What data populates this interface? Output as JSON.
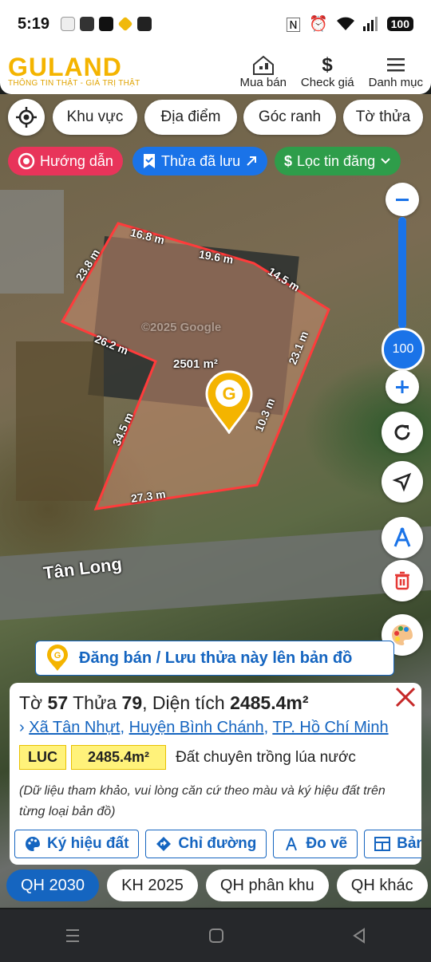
{
  "status_bar": {
    "time": "5:19",
    "battery": "100"
  },
  "header": {
    "logo_word": "GULAND",
    "logo_tagline": "THÔNG TIN THẬT - GIÁ TRỊ THẬT",
    "nav": [
      {
        "label": "Mua bán",
        "icon": "house-icon"
      },
      {
        "label": "Check giá",
        "icon": "dollar-icon"
      },
      {
        "label": "Danh mục",
        "icon": "menu-icon"
      }
    ]
  },
  "filters": {
    "location_icon": "crosshair-icon",
    "chips": [
      "Khu vực",
      "Địa điểm",
      "Góc ranh",
      "Tờ thửa"
    ]
  },
  "quick_actions": {
    "guide": "Hướng dẫn",
    "saved": "Thửa đã lưu",
    "filter": "Lọc tin đăng"
  },
  "map": {
    "watermark": "©2025 Google",
    "area_label": "2501 m²",
    "road_name": "Tân Long",
    "edge_labels": [
      "16.8 m",
      "19.6 m",
      "14.5 m",
      "23.8 m",
      "26.2 m",
      "23.1 m",
      "10.3 m",
      "34.5 m",
      "27.3 m"
    ],
    "zoom_value": "100",
    "colors": {
      "boundary": "#ff3b3b",
      "primary": "#1565c0",
      "accent": "#f4b400"
    }
  },
  "controls": [
    "zoom-out",
    "zoom-in",
    "refresh",
    "navigate",
    "measure",
    "delete",
    "palette"
  ],
  "banner": "Đăng bán / Lưu thửa này lên bản đồ",
  "parcel": {
    "to_label": "Tờ",
    "to": "57",
    "thua_label": "Thửa",
    "thua": "79",
    "area_label": "Diện tích",
    "area": "2485.4m²",
    "address": {
      "commune": "Xã Tân Nhựt",
      "district": "Huyện Bình Chánh",
      "city": "TP. Hồ Chí Minh"
    },
    "land_code": "LUC",
    "land_area": "2485.4m²",
    "land_type": "Đất chuyên trồng lúa nước",
    "note": "(Dữ liệu tham khảo, vui lòng căn cứ theo màu và ký hiệu đất trên từng loại bản đồ)"
  },
  "card_actions": [
    "Ký hiệu đất",
    "Chỉ đường",
    "Đo vẽ",
    "Bảng"
  ],
  "plan_tabs": [
    "QH 2030",
    "KH 2025",
    "QH phân khu",
    "QH khác"
  ],
  "active_tab": "QH 2030"
}
